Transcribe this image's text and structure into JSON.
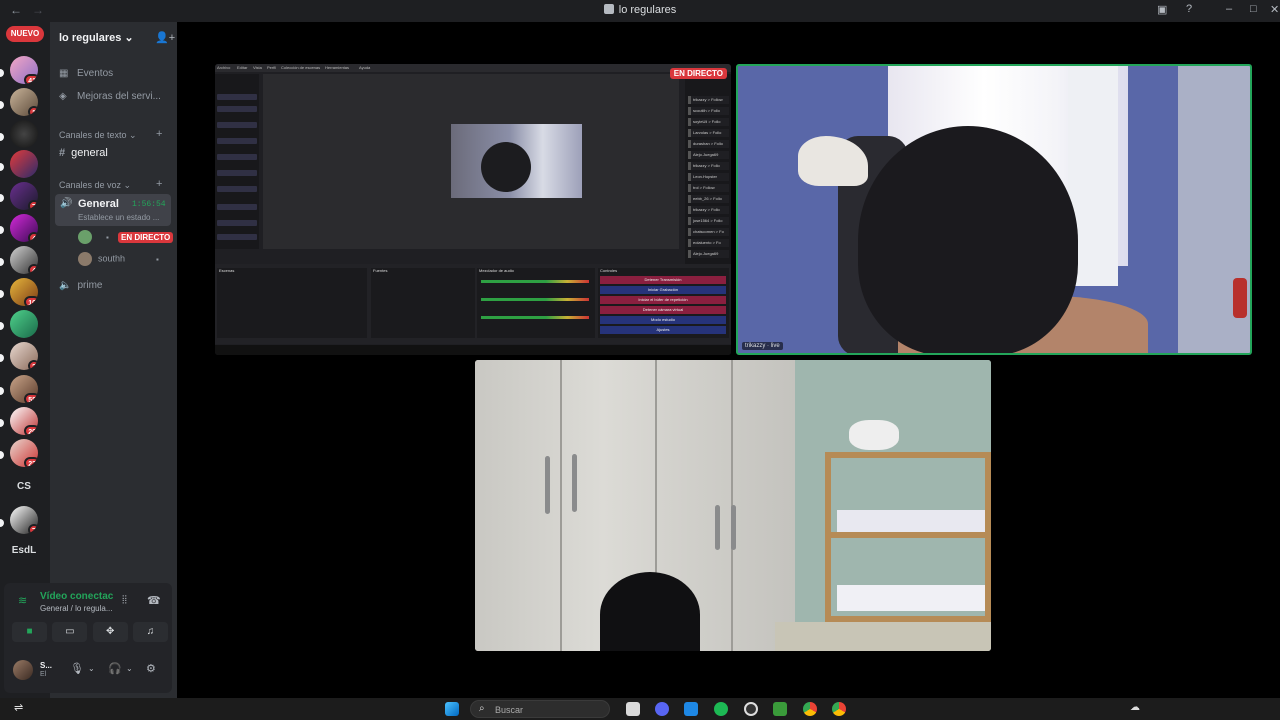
{
  "window": {
    "title": "lo regulares",
    "back_icon": "←",
    "forward_icon": "→"
  },
  "rail": {
    "new_label": "NUEVO",
    "badges": [
      "41",
      "1",
      "7",
      "4",
      "4",
      "10",
      "2",
      "58",
      "20",
      "23",
      "7"
    ],
    "text_servers": [
      "CS",
      "EsdL"
    ]
  },
  "server": {
    "name": "lo regulares ⌄",
    "events": "Eventos",
    "boosts": "Mejoras del servi...",
    "text_category": "Canales de texto ⌄",
    "text_channel": "general",
    "voice_category": "Canales de voz ⌄",
    "voice_channel": "General",
    "voice_timer": "1:56:54",
    "voice_status": "Establece un estado ...",
    "live_badge": "EN DIRECTO",
    "member2": "southh",
    "voice_channel2": "prime"
  },
  "voice_panel": {
    "connected": "Vídeo conectac",
    "location": "General / lo regula...",
    "user_name": "S...",
    "user_status": "El"
  },
  "obs": {
    "live_tag": "EN DIRECTO",
    "menu": [
      "Archivo",
      "Editar",
      "Vista",
      "Perfil",
      "Colección de escenas",
      "Herramientas",
      "Ayuda"
    ],
    "followers": [
      "trikazzy > Follow",
      "scoutiih > Follo",
      "soyteUli > Follo",
      "Larvolas > Follo",
      "durashan > Follo",
      "Alejo.Juega69",
      "trikazzy > Follo",
      "Leon.Hopster",
      "trol > Follow",
      "eebb_26 > Follo",
      "trikazzy > Follo",
      "jose1564 > Follo",
      "chatscomen > Fo",
      "eolaluento > Fo",
      "Alejo.Juega69"
    ],
    "panels": [
      "Escenas",
      "Fuentes",
      "Mezclador de audio",
      "Controles"
    ],
    "controls": [
      "Detener Transmisión",
      "Iniciar Grabación",
      "Iniciar el búfer de repetición",
      "Detener cámara virtual",
      "Modo estudio",
      "Ajustes"
    ]
  },
  "cam1": {
    "name_tag": "trikazzy · live"
  },
  "taskbar": {
    "search_placeholder": "Buscar"
  },
  "colors": {
    "accent_green": "#23a55a",
    "live_red": "#da373c",
    "sidebar_bg": "#2b2d31",
    "rail_bg": "#1e1f22"
  }
}
